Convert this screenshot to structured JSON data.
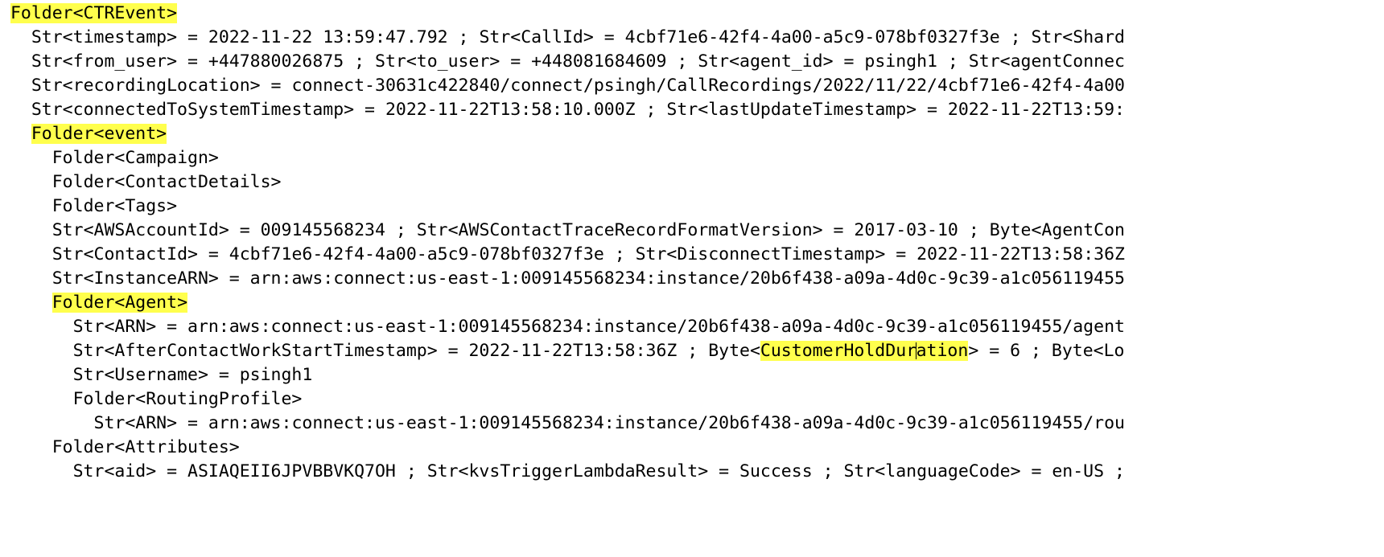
{
  "view": {
    "name": "ctr-event-tree",
    "background_color": "#ffffff",
    "text_color": "#000000",
    "highlight_color": "#ffff4d",
    "font_size_px": 21.5,
    "line_height_px": 30
  },
  "lines": [
    {
      "indent": 0,
      "highlight": "full",
      "text": "Folder<CTREvent>"
    },
    {
      "indent": 1,
      "highlight": "none",
      "text": "Str<timestamp> = 2022-11-22 13:59:47.792 ; Str<CallId> = 4cbf71e6-42f4-4a00-a5c9-078bf0327f3e ; Str<Shard"
    },
    {
      "indent": 1,
      "highlight": "none",
      "text": "Str<from_user> = +447880026875 ; Str<to_user> = +448081684609 ; Str<agent_id> = psingh1 ; Str<agentConnec"
    },
    {
      "indent": 1,
      "highlight": "none",
      "text": "Str<recordingLocation> = connect-30631c422840/connect/psingh/CallRecordings/2022/11/22/4cbf71e6-42f4-4a00"
    },
    {
      "indent": 1,
      "highlight": "none",
      "text": "Str<connectedToSystemTimestamp> = 2022-11-22T13:58:10.000Z ; Str<lastUpdateTimestamp> = 2022-11-22T13:59:"
    },
    {
      "indent": 1,
      "highlight": "full",
      "text": "Folder<event>"
    },
    {
      "indent": 2,
      "highlight": "none",
      "text": "Folder<Campaign>"
    },
    {
      "indent": 2,
      "highlight": "none",
      "text": "Folder<ContactDetails>"
    },
    {
      "indent": 2,
      "highlight": "none",
      "text": "Folder<Tags>"
    },
    {
      "indent": 2,
      "highlight": "none",
      "text": "Str<AWSAccountId> = 009145568234 ; Str<AWSContactTraceRecordFormatVersion> = 2017-03-10 ; Byte<AgentCon"
    },
    {
      "indent": 2,
      "highlight": "none",
      "text": "Str<ContactId> = 4cbf71e6-42f4-4a00-a5c9-078bf0327f3e ; Str<DisconnectTimestamp> = 2022-11-22T13:58:36Z"
    },
    {
      "indent": 2,
      "highlight": "none",
      "text": "Str<InstanceARN> = arn:aws:connect:us-east-1:009145568234:instance/20b6f438-a09a-4d0c-9c39-a1c056119455"
    },
    {
      "indent": 2,
      "highlight": "full",
      "text": "Folder<Agent>"
    },
    {
      "indent": 3,
      "highlight": "none",
      "text": "Str<ARN> = arn:aws:connect:us-east-1:009145568234:instance/20b6f438-a09a-4d0c-9c39-a1c056119455/agent"
    },
    {
      "indent": 3,
      "highlight": "partial",
      "prefix": "Str<AfterContactWorkStartTimestamp> = 2022-11-22T13:58:36Z ; Byte<",
      "highlighted_before_caret": "CustomerHoldDur",
      "caret": true,
      "highlighted_after_caret": "ation",
      "suffix": "> = 6 ; Byte<Lo",
      "text": "Str<AfterContactWorkStartTimestamp> = 2022-11-22T13:58:36Z ; Byte<CustomerHoldDuration> = 6 ; Byte<Lo"
    },
    {
      "indent": 3,
      "highlight": "none",
      "text": "Str<Username> = psingh1"
    },
    {
      "indent": 3,
      "highlight": "none",
      "text": "Folder<RoutingProfile>"
    },
    {
      "indent": 4,
      "highlight": "none",
      "text": "Str<ARN> = arn:aws:connect:us-east-1:009145568234:instance/20b6f438-a09a-4d0c-9c39-a1c056119455/rou"
    },
    {
      "indent": 2,
      "highlight": "none",
      "text": "Folder<Attributes>"
    },
    {
      "indent": 3,
      "highlight": "none",
      "text": "Str<aid> = ASIAQEII6JPVBBVKQ7OH ; Str<kvsTriggerLambdaResult> = Success ; Str<languageCode> = en-US ;"
    }
  ]
}
